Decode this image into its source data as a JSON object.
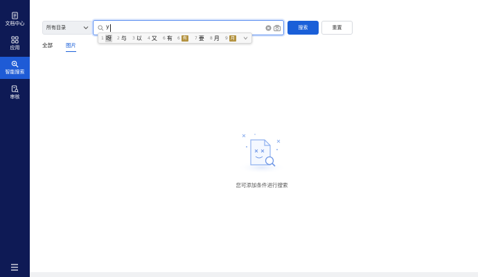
{
  "sidebar": {
    "items": [
      {
        "label": "文档中心",
        "icon": "document-icon",
        "active": false
      },
      {
        "label": "应用",
        "icon": "grid-icon",
        "active": false
      },
      {
        "label": "智能搜索",
        "icon": "smart-search-icon",
        "active": true
      },
      {
        "label": "审核",
        "icon": "review-icon",
        "active": false
      }
    ],
    "menu_icon": "hamburger-icon"
  },
  "toolbar": {
    "directory_select": "所有目录",
    "search_value": "y",
    "search_button": "搜索",
    "reset_button": "重置"
  },
  "ime": {
    "candidates": [
      {
        "n": "1",
        "c": "呀"
      },
      {
        "n": "2",
        "c": "与"
      },
      {
        "n": "3",
        "c": "以"
      },
      {
        "n": "4",
        "c": "又"
      },
      {
        "n": "6",
        "c": "有"
      },
      {
        "n": "7",
        "c": "要"
      },
      {
        "n": "8",
        "c": "月"
      }
    ],
    "emoji_candidates": [
      {
        "n": "6",
        "c": "有"
      },
      {
        "n": "9",
        "c": "月"
      }
    ]
  },
  "tabs": [
    {
      "label": "全部",
      "active": false
    },
    {
      "label": "图片",
      "active": true
    }
  ],
  "empty_state": {
    "message": "您可添加条件进行搜索"
  },
  "colors": {
    "sidebar_bg": "#0e1a55",
    "accent": "#1a5fd8",
    "active_nav": "#1e5bd6"
  }
}
